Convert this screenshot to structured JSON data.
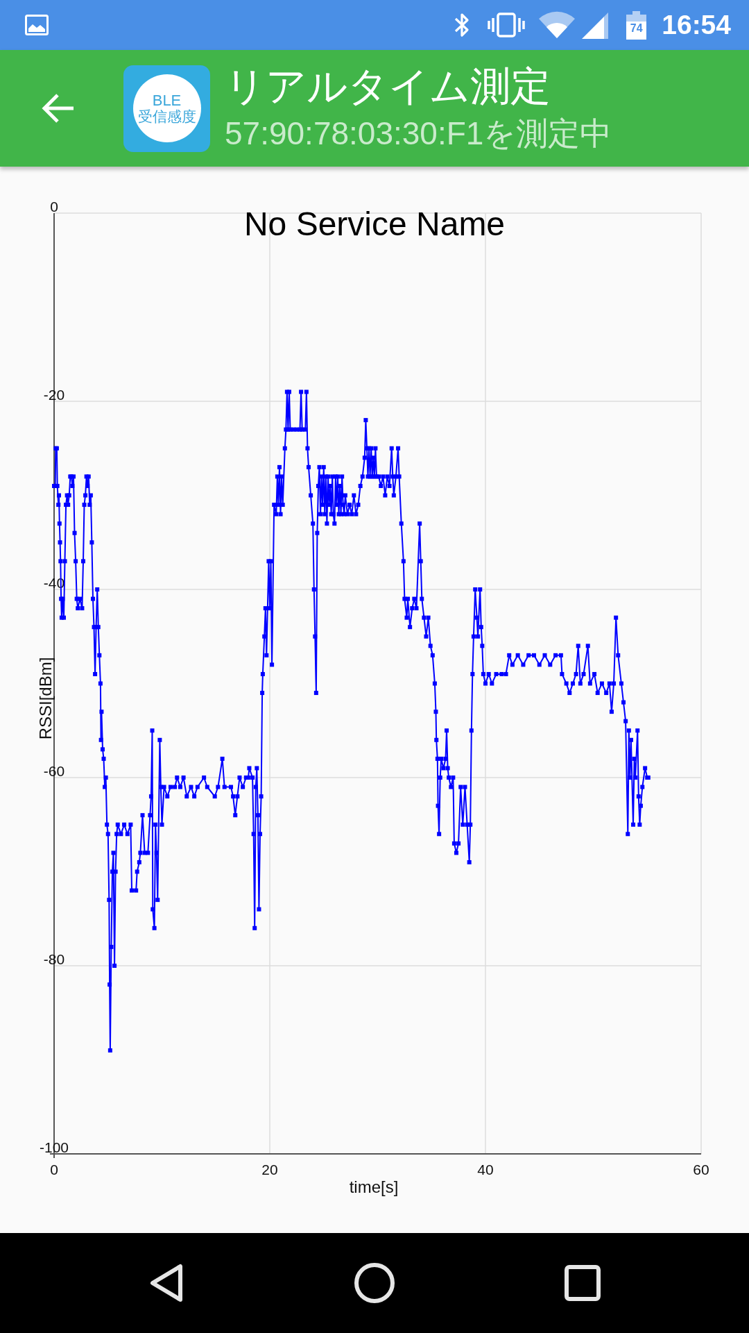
{
  "status_bar": {
    "battery_percent": "74",
    "time": "16:54"
  },
  "app_bar": {
    "app_icon": {
      "line_1": "BLE",
      "line_2": "受信感度"
    },
    "title": "リアルタイム測定",
    "subtitle": "57:90:78:03:30:F1を測定中"
  },
  "chart": {
    "chart_data": {
      "type": "line",
      "title": "No Service Name",
      "xlabel": "time[s]",
      "ylabel": "RSSI[dBm]",
      "grid": true,
      "x": [
        0,
        0.1,
        0.15,
        0.25,
        0.3,
        0.4,
        0.45,
        0.5,
        0.55,
        0.6,
        0.65,
        0.7,
        0.8,
        0.9,
        1,
        1.1,
        1.2,
        1.3,
        1.4,
        1.5,
        1.6,
        1.7,
        1.8,
        1.9,
        2,
        2.1,
        2.2,
        2.4,
        2.6,
        2.7,
        2.8,
        2.9,
        3,
        3.1,
        3.2,
        3.3,
        3.4,
        3.5,
        3.6,
        3.7,
        3.8,
        3.9,
        4,
        4.1,
        4.2,
        4.3,
        4.35,
        4.4,
        4.5,
        4.6,
        4.7,
        4.8,
        4.9,
        5,
        5.1,
        5.15,
        5.2,
        5.3,
        5.4,
        5.5,
        5.6,
        5.7,
        5.8,
        5.9,
        6.2,
        6.5,
        6.8,
        7.1,
        7.2,
        7.6,
        7.7,
        7.9,
        8,
        8.2,
        8.4,
        8.7,
        8.9,
        9,
        9.1,
        9.15,
        9.3,
        9.4,
        9.5,
        9.6,
        9.8,
        9.9,
        10,
        10.2,
        10.5,
        10.8,
        11.2,
        11.4,
        11.7,
        12,
        12.3,
        12.7,
        13,
        13.3,
        13.9,
        14.2,
        14.9,
        15.2,
        15.6,
        15.8,
        16.4,
        16.6,
        16.8,
        17,
        17.2,
        17.5,
        17.8,
        18,
        18.1,
        18.4,
        18.5,
        18.6,
        18.7,
        18.8,
        18.9,
        19,
        19.1,
        19.2,
        19.3,
        19.35,
        19.5,
        19.6,
        19.7,
        19.9,
        20,
        20.1,
        20.2,
        20.4,
        20.6,
        20.7,
        20.8,
        20.9,
        21,
        21.1,
        21.2,
        21.4,
        21.5,
        21.6,
        21.7,
        21.8,
        21.9,
        22.2,
        22.5,
        22.8,
        22.9,
        23,
        23.3,
        23.4,
        23.5,
        23.6,
        23.8,
        24,
        24.1,
        24.2,
        24.3,
        24.4,
        24.5,
        24.6,
        24.7,
        24.8,
        24.9,
        25,
        25.1,
        25.2,
        25.3,
        25.4,
        25.5,
        25.6,
        25.7,
        25.8,
        25.9,
        26,
        26.1,
        26.2,
        26.3,
        26.4,
        26.5,
        26.6,
        26.7,
        26.8,
        26.9,
        27,
        27.2,
        27.4,
        27.6,
        27.8,
        28,
        28.2,
        28.4,
        28.6,
        28.8,
        28.9,
        29,
        29.1,
        29.2,
        29.3,
        29.4,
        29.5,
        29.6,
        29.7,
        29.8,
        29.9,
        30.1,
        30.3,
        30.5,
        30.7,
        30.9,
        31.1,
        31.3,
        31.4,
        31.5,
        31.7,
        31.9,
        32,
        32.2,
        32.4,
        32.5,
        32.7,
        32.8,
        33,
        33.2,
        33.4,
        33.6,
        33.9,
        34,
        34.1,
        34.3,
        34.5,
        34.7,
        34.9,
        35.1,
        35.3,
        35.4,
        35.45,
        35.55,
        35.6,
        35.7,
        35.8,
        35.9,
        36.1,
        36.3,
        36.4,
        36.5,
        36.6,
        36.8,
        37,
        37.1,
        37.3,
        37.5,
        37.7,
        37.9,
        38.1,
        38.3,
        38.5,
        38.6,
        38.7,
        38.8,
        38.9,
        39.05,
        39.2,
        39.3,
        39.5,
        39.6,
        39.7,
        39.8,
        40,
        40.3,
        40.6,
        41,
        41.5,
        41.9,
        42.2,
        42.5,
        43,
        43.5,
        44,
        44.5,
        45,
        45.5,
        46,
        46.5,
        47,
        47.1,
        47.5,
        47.8,
        48.1,
        48.4,
        48.6,
        48.8,
        49.1,
        49.5,
        49.7,
        50.1,
        50.4,
        50.8,
        51.2,
        51.5,
        51.7,
        51.9,
        52.1,
        52.3,
        52.6,
        52.8,
        53,
        53.2,
        53.3,
        53.4,
        53.5,
        53.7,
        53.8,
        53.9,
        54.1,
        54.2,
        54.3,
        54.4,
        54.55,
        54.8,
        55,
        55.1
      ],
      "series": [
        {
          "color": "#0000ff",
          "marker": "square",
          "values": [
            -29,
            -29,
            -25,
            -25,
            -29,
            -31,
            -30,
            -33,
            -35,
            -37,
            -41,
            -43,
            -41,
            -43,
            -37,
            -31,
            -30,
            -31,
            -30,
            -28,
            -28,
            -29,
            -28,
            -34,
            -37,
            -41,
            -42,
            -41,
            -42,
            -37,
            -31,
            -30,
            -28,
            -29,
            -28,
            -31,
            -30,
            -35,
            -41,
            -44,
            -49,
            -44,
            -40,
            -44,
            -47,
            -50,
            -56,
            -53,
            -57,
            -58,
            -61,
            -60,
            -65,
            -66,
            -73,
            -82,
            -89,
            -78,
            -70,
            -68,
            -80,
            -70,
            -66,
            -65,
            -66,
            -65,
            -66,
            -65,
            -72,
            -72,
            -70,
            -69,
            -68,
            -64,
            -68,
            -68,
            -64,
            -62,
            -55,
            -74,
            -76,
            -65,
            -68,
            -73,
            -56,
            -61,
            -65,
            -61,
            -62,
            -61,
            -61,
            -60,
            -61,
            -60,
            -62,
            -61,
            -62,
            -61,
            -60,
            -61,
            -62,
            -61,
            -58,
            -61,
            -61,
            -62,
            -64,
            -62,
            -60,
            -61,
            -60,
            -60,
            -59,
            -60,
            -66,
            -76,
            -61,
            -59,
            -64,
            -74,
            -66,
            -62,
            -51,
            -49,
            -45,
            -42,
            -47,
            -37,
            -42,
            -37,
            -48,
            -31,
            -32,
            -28,
            -31,
            -27,
            -32,
            -28,
            -31,
            -25,
            -23,
            -19,
            -23,
            -19,
            -23,
            -23,
            -23,
            -23,
            -19,
            -23,
            -23,
            -19,
            -25,
            -27,
            -30,
            -33,
            -40,
            -45,
            -51,
            -34,
            -29,
            -27,
            -32,
            -28,
            -31,
            -27,
            -32,
            -28,
            -33,
            -28,
            -31,
            -29,
            -32,
            -28,
            -32,
            -33,
            -28,
            -31,
            -28,
            -32,
            -29,
            -32,
            -28,
            -31,
            -32,
            -30,
            -32,
            -31,
            -32,
            -30,
            -32,
            -31,
            -29,
            -28,
            -26,
            -22,
            -25,
            -28,
            -25,
            -28,
            -25,
            -28,
            -26,
            -28,
            -25,
            -28,
            -28,
            -29,
            -28,
            -30,
            -28,
            -29,
            -25,
            -28,
            -30,
            -28,
            -25,
            -28,
            -33,
            -37,
            -41,
            -43,
            -41,
            -44,
            -42,
            -41,
            -42,
            -33,
            -37,
            -41,
            -43,
            -45,
            -43,
            -46,
            -47,
            -50,
            -53,
            -56,
            -58,
            -63,
            -66,
            -60,
            -58,
            -59,
            -58,
            -55,
            -59,
            -60,
            -61,
            -60,
            -67,
            -68,
            -67,
            -61,
            -65,
            -61,
            -65,
            -69,
            -65,
            -55,
            -49,
            -45,
            -40,
            -43,
            -45,
            -40,
            -44,
            -46,
            -49,
            -50,
            -49,
            -50,
            -49,
            -49,
            -49,
            -47,
            -48,
            -47,
            -48,
            -47,
            -47,
            -48,
            -47,
            -48,
            -47,
            -47,
            -49,
            -50,
            -51,
            -50,
            -49,
            -46,
            -50,
            -49,
            -46,
            -50,
            -49,
            -51,
            -50,
            -51,
            -50,
            -53,
            -50,
            -43,
            -47,
            -50,
            -52,
            -54,
            -66,
            -55,
            -60,
            -56,
            -65,
            -58,
            -60,
            -55,
            -62,
            -65,
            -63,
            -61,
            -59,
            -60,
            -60
          ]
        }
      ],
      "xlim": [
        0,
        60
      ],
      "ylim": [
        -100,
        0
      ],
      "xticks": [
        0,
        20,
        40,
        60
      ],
      "yticks": [
        -100,
        -80,
        -60,
        -40,
        -20,
        0
      ]
    }
  }
}
